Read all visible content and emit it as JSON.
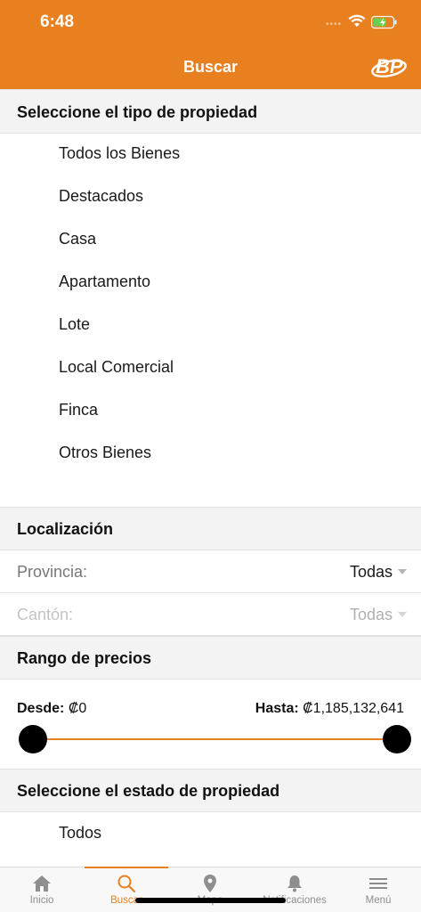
{
  "status": {
    "time": "6:48",
    "dots": "••••"
  },
  "header": {
    "title": "Buscar",
    "logo_text": "BP"
  },
  "property_type": {
    "heading": "Seleccione el tipo de propiedad",
    "items": [
      "Todos los Bienes",
      "Destacados",
      "Casa",
      "Apartamento",
      "Lote",
      "Local Comercial",
      "Finca",
      "Otros Bienes"
    ]
  },
  "location": {
    "heading": "Localización",
    "province_label": "Provincia:",
    "province_value": "Todas",
    "canton_label": "Cantón:",
    "canton_value": "Todas"
  },
  "price_range": {
    "heading": "Rango de precios",
    "from_label": "Desde:",
    "from_value": "₡0",
    "to_label": "Hasta:",
    "to_value": "₡1,185,132,641"
  },
  "property_state": {
    "heading": "Seleccione el estado de propiedad",
    "items": [
      "Todos"
    ]
  },
  "tabbar": {
    "tabs": [
      "Inicio",
      "Buscar",
      "Mapa",
      "Notificaciones",
      "Menú"
    ],
    "active": "Buscar"
  },
  "colors": {
    "accent": "#e9801f",
    "section_bg": "#f3f3f3"
  }
}
